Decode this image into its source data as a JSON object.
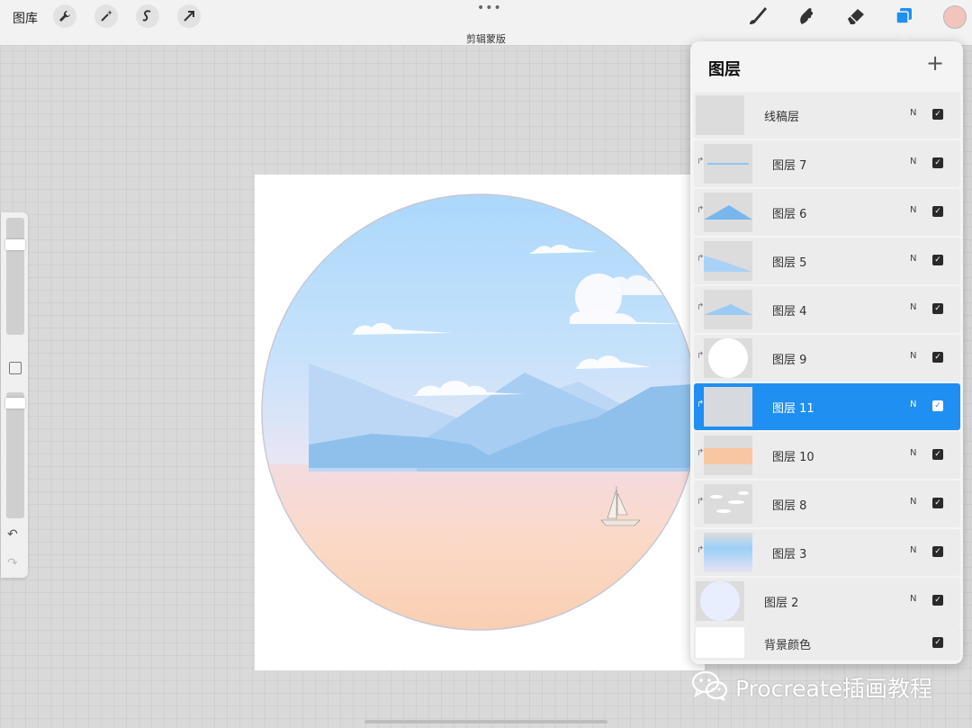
{
  "topbar": {
    "gallery_label": "图库",
    "menu_dots": "•••",
    "subtitle": "剪辑蒙版",
    "left_tools": [
      "wrench-icon",
      "magic-wand-icon",
      "selection-icon",
      "transform-arrow-icon"
    ],
    "right_tools": [
      "brush-icon",
      "smudge-icon",
      "eraser-icon",
      "layers-icon"
    ],
    "current_color": "#f2c4bc",
    "accent": "#1f8ff2"
  },
  "sidebar": {
    "size_level": 0.2,
    "opacity_level": 0.05,
    "undo_icon": "↶",
    "redo_icon": "↷"
  },
  "layers_panel": {
    "title": "图层",
    "add_icon": "+",
    "layers": [
      {
        "name": "线稿层",
        "blend": "N",
        "visible": true,
        "clipped": false
      },
      {
        "name": "图层 7",
        "blend": "N",
        "visible": true,
        "clipped": true
      },
      {
        "name": "图层 6",
        "blend": "N",
        "visible": true,
        "clipped": true
      },
      {
        "name": "图层 5",
        "blend": "N",
        "visible": true,
        "clipped": true
      },
      {
        "name": "图层 4",
        "blend": "N",
        "visible": true,
        "clipped": true
      },
      {
        "name": "图层 9",
        "blend": "N",
        "visible": true,
        "clipped": true
      },
      {
        "name": "图层 11",
        "blend": "N",
        "visible": true,
        "clipped": true,
        "selected": true
      },
      {
        "name": "图层 10",
        "blend": "N",
        "visible": true,
        "clipped": true
      },
      {
        "name": "图层 8",
        "blend": "N",
        "visible": true,
        "clipped": true
      },
      {
        "name": "图层 3",
        "blend": "N",
        "visible": true,
        "clipped": true
      },
      {
        "name": "图层 2",
        "blend": "N",
        "visible": true,
        "clipped": false
      },
      {
        "name": "背景颜色",
        "blend": "",
        "visible": true,
        "clipped": false
      }
    ]
  },
  "watermark": {
    "text": "Procreate插画教程",
    "icon": "wechat-icon"
  }
}
